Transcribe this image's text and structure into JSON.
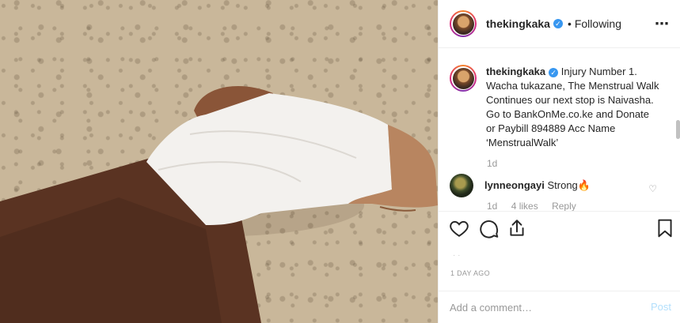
{
  "header": {
    "username": "thekingkaka",
    "verified_icon": "verified-badge-icon",
    "separator": "•",
    "follow_status": "Following",
    "more_icon": "more-options-icon"
  },
  "caption": {
    "username": "thekingkaka",
    "text": "Injury Number 1. Wacha tukazane, The Menstrual Walk Continues our next stop is Naivasha. Go to BankOnMe.co.ke and Donate or Paybill 894889 Acc Name ‘MenstrualWalk’",
    "time": "1d"
  },
  "comment": {
    "username": "lynneongayi",
    "text": "Strong",
    "emoji": "🔥",
    "time": "1d",
    "likes": "4 likes",
    "reply_label": "Reply"
  },
  "actions": {
    "icons": [
      "heart-icon",
      "comment-icon",
      "share-icon",
      "bookmark-icon"
    ]
  },
  "post": {
    "time_ago": "1 DAY AGO"
  },
  "add_comment": {
    "placeholder": "Add a comment…",
    "post_label": "Post"
  },
  "colors": {
    "verified": "#3897f0",
    "post_button": "#b2dffc",
    "muted_text": "#999999"
  }
}
